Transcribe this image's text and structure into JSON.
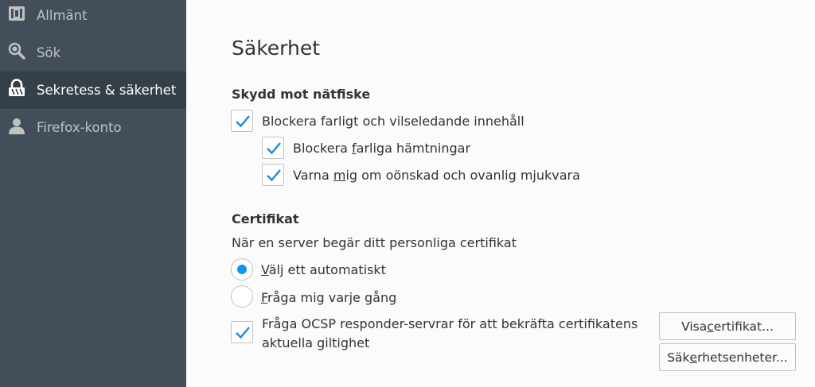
{
  "sidebar": {
    "items": [
      {
        "label": "Allmänt",
        "icon": "general-icon",
        "selected": false
      },
      {
        "label": "Sök",
        "icon": "search-icon",
        "selected": false
      },
      {
        "label": "Sekretess & säkerhet",
        "icon": "lock-icon",
        "selected": true
      },
      {
        "label": "Firefox-konto",
        "icon": "account-icon",
        "selected": false
      }
    ]
  },
  "main": {
    "title": "Säkerhet",
    "phishing": {
      "heading": "Skydd mot nätfiske",
      "block_dangerous": {
        "label": "Blockera farligt och vilseledande innehåll",
        "checked": true
      },
      "block_downloads": {
        "label_pre": "Blockera ",
        "label_ul": "f",
        "label_post": "arliga hämtningar",
        "checked": true
      },
      "warn_unwanted": {
        "label_pre": "Varna ",
        "label_ul": "m",
        "label_post": "ig om oönskad och ovanlig mjukvara",
        "checked": true
      }
    },
    "certificates": {
      "heading": "Certifikat",
      "description": "När en server begär ditt personliga certifikat",
      "auto_select": {
        "label_ul": "V",
        "label_post": "älj ett automatiskt",
        "selected": true
      },
      "ask_every_time": {
        "label_ul": "F",
        "label_post": "råga mig varje gång",
        "selected": false
      },
      "ocsp": {
        "line1": "Fråga OCSP responder-servrar för att bekräfta certifikatens",
        "line2": "aktuella giltighet",
        "checked": true
      },
      "view_certificates_button": {
        "label_pre": "Visa ",
        "label_ul": "c",
        "label_post": "ertifikat..."
      },
      "security_devices_button": {
        "label_pre": "Säk",
        "label_ul": "e",
        "label_post": "rhetsenheter..."
      }
    }
  },
  "colors": {
    "sidebar_bg": "#424f5a",
    "sidebar_selected_bg": "#343f48",
    "accent": "#0996f8",
    "check": "#1c8cd6"
  }
}
